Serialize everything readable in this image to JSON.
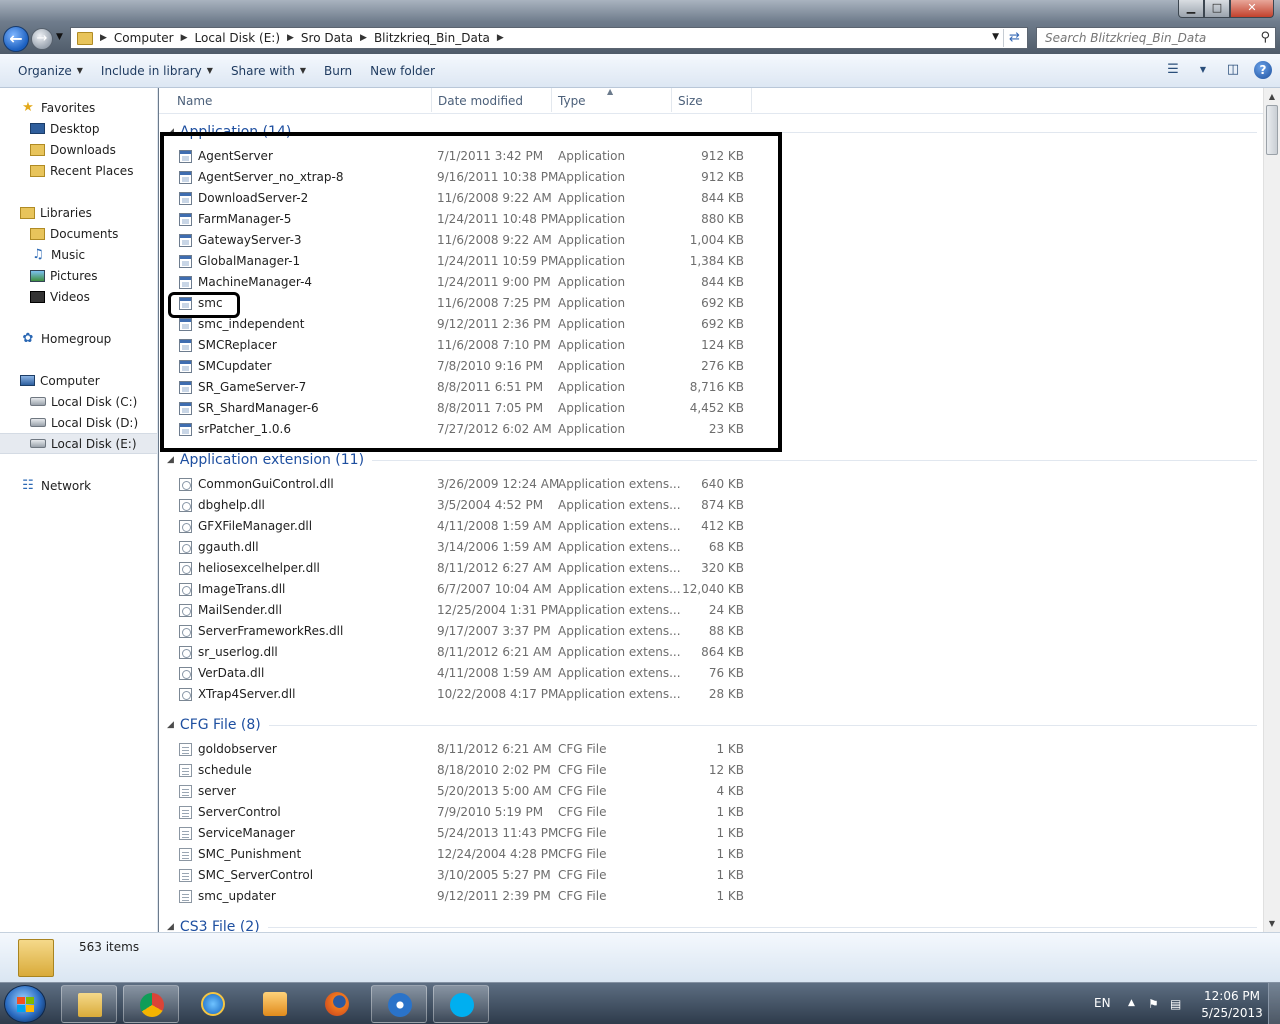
{
  "window": {
    "minimize": "▁",
    "maximize": "□",
    "close": "✕"
  },
  "address": {
    "crumbs": [
      "Computer",
      "Local Disk (E:)",
      "Sro Data",
      "Blitzkrieq_Bin_Data"
    ],
    "search_placeholder": "Search Blitzkrieq_Bin_Data"
  },
  "toolbar": {
    "organize": "Organize",
    "include_in_library": "Include in library",
    "share_with": "Share with",
    "burn": "Burn",
    "new_folder": "New folder"
  },
  "nav": {
    "favorites": "Favorites",
    "desktop": "Desktop",
    "downloads": "Downloads",
    "recent_places": "Recent Places",
    "libraries": "Libraries",
    "documents": "Documents",
    "music": "Music",
    "pictures": "Pictures",
    "videos": "Videos",
    "homegroup": "Homegroup",
    "computer": "Computer",
    "disk_c": "Local Disk (C:)",
    "disk_d": "Local Disk (D:)",
    "disk_e": "Local Disk (E:)",
    "network": "Network"
  },
  "columns": {
    "name": "Name",
    "date_modified": "Date modified",
    "type": "Type",
    "size": "Size"
  },
  "groups": [
    {
      "label": "Application (14)",
      "icon": "application-file-icon",
      "files": [
        {
          "name": "AgentServer",
          "date": "7/1/2011 3:42 PM",
          "type": "Application",
          "size": "912 KB"
        },
        {
          "name": "AgentServer_no_xtrap-8",
          "date": "9/16/2011 10:38 PM",
          "type": "Application",
          "size": "912 KB"
        },
        {
          "name": "DownloadServer-2",
          "date": "11/6/2008 9:22 AM",
          "type": "Application",
          "size": "844 KB"
        },
        {
          "name": "FarmManager-5",
          "date": "1/24/2011 10:48 PM",
          "type": "Application",
          "size": "880 KB"
        },
        {
          "name": "GatewayServer-3",
          "date": "11/6/2008 9:22 AM",
          "type": "Application",
          "size": "1,004 KB"
        },
        {
          "name": "GlobalManager-1",
          "date": "1/24/2011 10:59 PM",
          "type": "Application",
          "size": "1,384 KB"
        },
        {
          "name": "MachineManager-4",
          "date": "1/24/2011 9:00 PM",
          "type": "Application",
          "size": "844 KB"
        },
        {
          "name": "smc",
          "date": "11/6/2008 7:25 PM",
          "type": "Application",
          "size": "692 KB"
        },
        {
          "name": "smc_independent",
          "date": "9/12/2011 2:36 PM",
          "type": "Application",
          "size": "692 KB"
        },
        {
          "name": "SMCReplacer",
          "date": "11/6/2008 7:10 PM",
          "type": "Application",
          "size": "124 KB"
        },
        {
          "name": "SMCupdater",
          "date": "7/8/2010 9:16 PM",
          "type": "Application",
          "size": "276 KB"
        },
        {
          "name": "SR_GameServer-7",
          "date": "8/8/2011 6:51 PM",
          "type": "Application",
          "size": "8,716 KB"
        },
        {
          "name": "SR_ShardManager-6",
          "date": "8/8/2011 7:05 PM",
          "type": "Application",
          "size": "4,452 KB"
        },
        {
          "name": "srPatcher_1.0.6",
          "date": "7/27/2012 6:02 AM",
          "type": "Application",
          "size": "23 KB"
        }
      ]
    },
    {
      "label": "Application extension (11)",
      "icon": "dll-file-icon",
      "files": [
        {
          "name": "CommonGuiControl.dll",
          "date": "3/26/2009 12:24 AM",
          "type": "Application extens...",
          "size": "640 KB"
        },
        {
          "name": "dbghelp.dll",
          "date": "3/5/2004 4:52 PM",
          "type": "Application extens...",
          "size": "874 KB"
        },
        {
          "name": "GFXFileManager.dll",
          "date": "4/11/2008 1:59 AM",
          "type": "Application extens...",
          "size": "412 KB"
        },
        {
          "name": "ggauth.dll",
          "date": "3/14/2006 1:59 AM",
          "type": "Application extens...",
          "size": "68 KB"
        },
        {
          "name": "heliosexcelhelper.dll",
          "date": "8/11/2012 6:27 AM",
          "type": "Application extens...",
          "size": "320 KB"
        },
        {
          "name": "ImageTrans.dll",
          "date": "6/7/2007 10:04 AM",
          "type": "Application extens...",
          "size": "12,040 KB"
        },
        {
          "name": "MailSender.dll",
          "date": "12/25/2004 1:31 PM",
          "type": "Application extens...",
          "size": "24 KB"
        },
        {
          "name": "ServerFrameworkRes.dll",
          "date": "9/17/2007 3:37 PM",
          "type": "Application extens...",
          "size": "88 KB"
        },
        {
          "name": "sr_userlog.dll",
          "date": "8/11/2012 6:21 AM",
          "type": "Application extens...",
          "size": "864 KB"
        },
        {
          "name": "VerData.dll",
          "date": "4/11/2008 1:59 AM",
          "type": "Application extens...",
          "size": "76 KB"
        },
        {
          "name": "XTrap4Server.dll",
          "date": "10/22/2008 4:17 PM",
          "type": "Application extens...",
          "size": "28 KB"
        }
      ]
    },
    {
      "label": "CFG File (8)",
      "icon": "cfg-file-icon",
      "files": [
        {
          "name": "goldobserver",
          "date": "8/11/2012 6:21 AM",
          "type": "CFG File",
          "size": "1 KB"
        },
        {
          "name": "schedule",
          "date": "8/18/2010 2:02 PM",
          "type": "CFG File",
          "size": "12 KB"
        },
        {
          "name": "server",
          "date": "5/20/2013 5:00 AM",
          "type": "CFG File",
          "size": "4 KB"
        },
        {
          "name": "ServerControl",
          "date": "7/9/2010 5:19 PM",
          "type": "CFG File",
          "size": "1 KB"
        },
        {
          "name": "ServiceManager",
          "date": "5/24/2013 11:43 PM",
          "type": "CFG File",
          "size": "1 KB"
        },
        {
          "name": "SMC_Punishment",
          "date": "12/24/2004 4:28 PM",
          "type": "CFG File",
          "size": "1 KB"
        },
        {
          "name": "SMC_ServerControl",
          "date": "3/10/2005 5:27 PM",
          "type": "CFG File",
          "size": "1 KB"
        },
        {
          "name": "smc_updater",
          "date": "9/12/2011 2:39 PM",
          "type": "CFG File",
          "size": "1 KB"
        }
      ]
    },
    {
      "label": "CS3 File (2)",
      "icon": "cs3-file-icon",
      "files": []
    }
  ],
  "status": {
    "item_count": "563 items"
  },
  "taskbar": {
    "lang": "EN",
    "time": "12:06 PM",
    "date": "5/25/2013"
  }
}
